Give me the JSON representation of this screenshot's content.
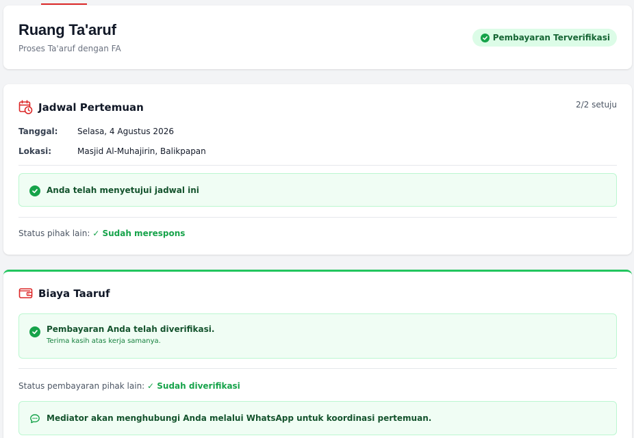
{
  "header": {
    "title": "Ruang Ta'aruf",
    "subtitle": "Proses Ta'aruf dengan FA",
    "badge": "Pembayaran Terverifikasi"
  },
  "schedule": {
    "title": "Jadwal Pertemuan",
    "consent": "2/2 setuju",
    "date_label": "Tanggal:",
    "date_value": "Selasa, 4 Agustus 2026",
    "location_label": "Lokasi:",
    "location_value": "Masjid Al-Muhajirin, Balikpapan",
    "approved_message": "Anda telah menyetujui jadwal ini",
    "other_status_label": "Status pihak lain:",
    "other_status_value": "✓ Sudah merespons"
  },
  "fee": {
    "title": "Biaya Taaruf",
    "verified_title": "Pembayaran Anda telah diverifikasi.",
    "verified_sub": "Terima kasih atas kerja samanya.",
    "other_status_label": "Status pembayaran pihak lain:",
    "other_status_value": "✓ Sudah diverifikasi",
    "mediator_message": "Mediator akan menghubungi Anda melalui WhatsApp untuk koordinasi pertemuan."
  },
  "colors": {
    "accent_red": "#dc2626",
    "success_green": "#16a34a",
    "success_bg": "#f0fdf4"
  },
  "icons": {
    "schedule": "calendar-clock-icon",
    "fee": "wallet-icon",
    "check": "check-circle-icon",
    "chat": "chat-bubble-icon"
  }
}
